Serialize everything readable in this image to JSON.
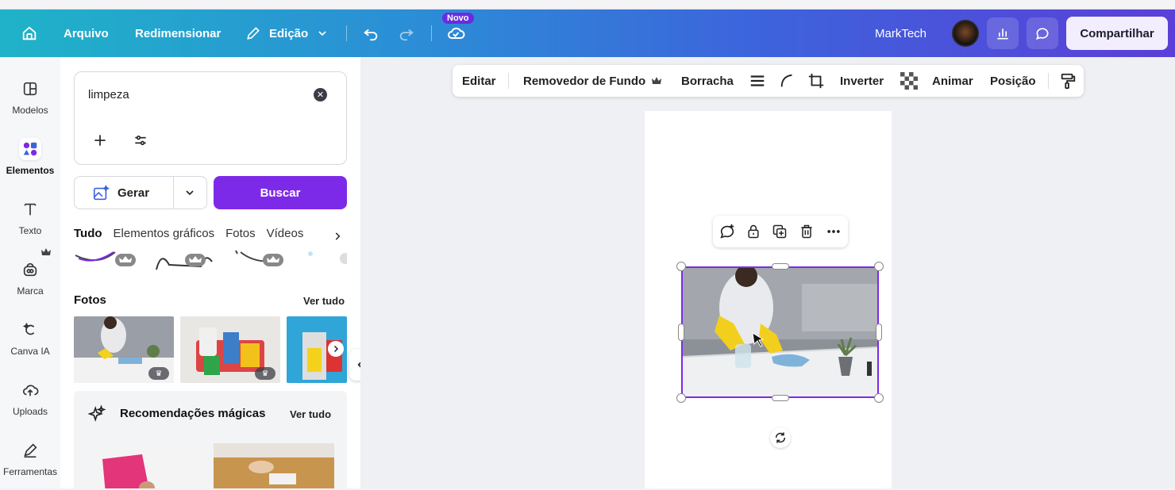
{
  "topbar": {
    "home_icon": "home-icon",
    "arquivo": "Arquivo",
    "redimensionar": "Redimensionar",
    "edicao": "Edição",
    "novo_badge": "Novo",
    "user_name": "MarkTech",
    "share_label": "Compartilhar"
  },
  "sidebar": {
    "items": [
      {
        "label": "Modelos",
        "icon": "templates-icon"
      },
      {
        "label": "Elementos",
        "icon": "elements-icon"
      },
      {
        "label": "Texto",
        "icon": "text-icon"
      },
      {
        "label": "Marca",
        "icon": "brand-icon"
      },
      {
        "label": "Canva IA",
        "icon": "ai-icon"
      },
      {
        "label": "Uploads",
        "icon": "upload-icon"
      },
      {
        "label": "Ferramentas",
        "icon": "tools-icon"
      }
    ]
  },
  "panel": {
    "search_value": "limpeza",
    "gerar_label": "Gerar",
    "buscar_label": "Buscar",
    "tabs": [
      "Tudo",
      "Elementos gráficos",
      "Fotos",
      "Vídeos"
    ],
    "fotos_heading": "Fotos",
    "fotos_link": "Ver tudo",
    "magic_heading": "Recomendações mágicas",
    "magic_link": "Ver tudo"
  },
  "toolbar": {
    "editar": "Editar",
    "removedor": "Removedor de Fundo",
    "borracha": "Borracha",
    "inverter": "Inverter",
    "animar": "Animar",
    "posicao": "Posição"
  },
  "colors": {
    "accent": "#7d2ae8",
    "topbar_start": "#1fb3c8",
    "topbar_end": "#5b3fd8"
  }
}
